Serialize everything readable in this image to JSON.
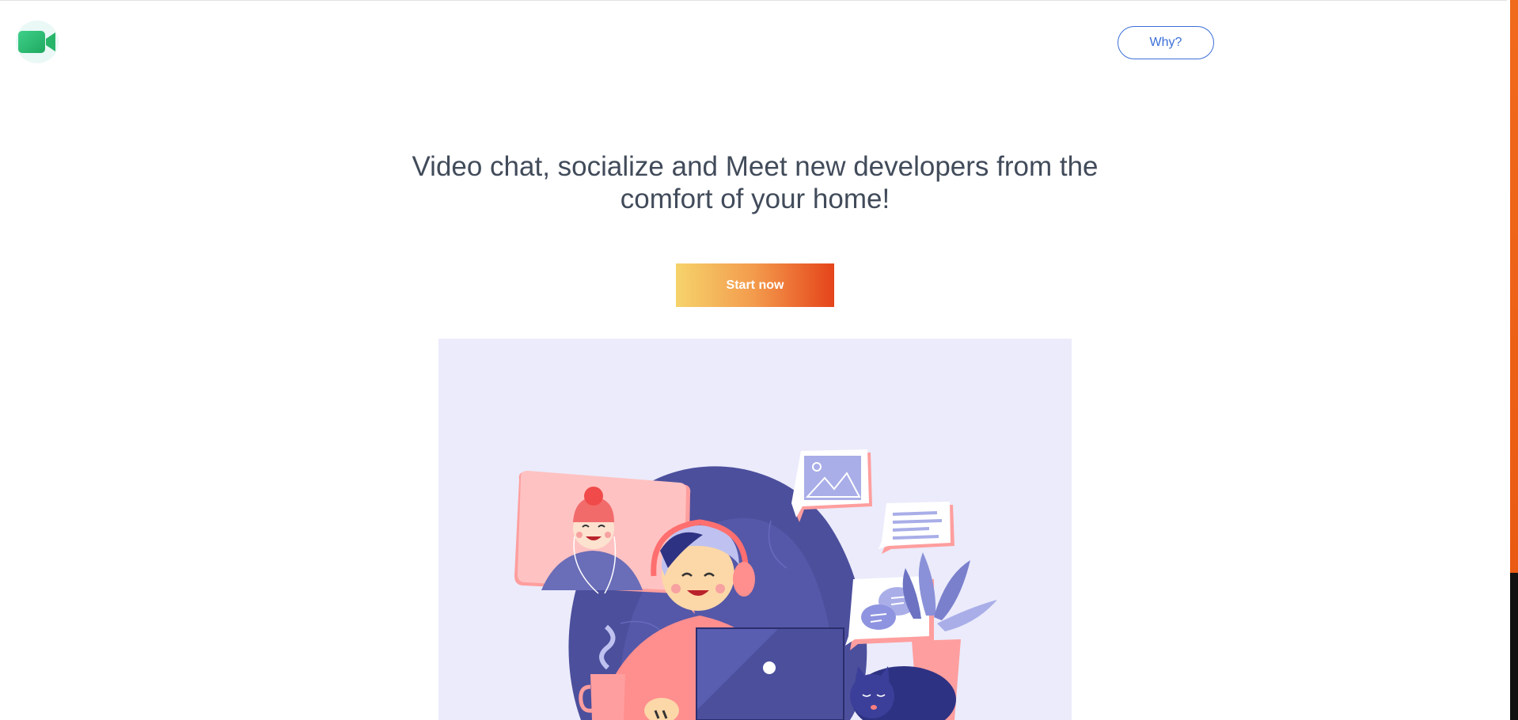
{
  "header": {
    "logo_icon": "video-camera-icon",
    "why_label": "Why?"
  },
  "hero": {
    "headline_line1": "Video chat, socialize and Meet new developers from the",
    "headline_line2": "comfort of your home!",
    "start_label": "Start now"
  },
  "colors": {
    "accent_blue": "#3b6fd8",
    "gradient_start": "#f6d36b",
    "gradient_end": "#e5441a",
    "illustration_bg": "#ebebfb",
    "scrollbar": "#f06a1d"
  }
}
